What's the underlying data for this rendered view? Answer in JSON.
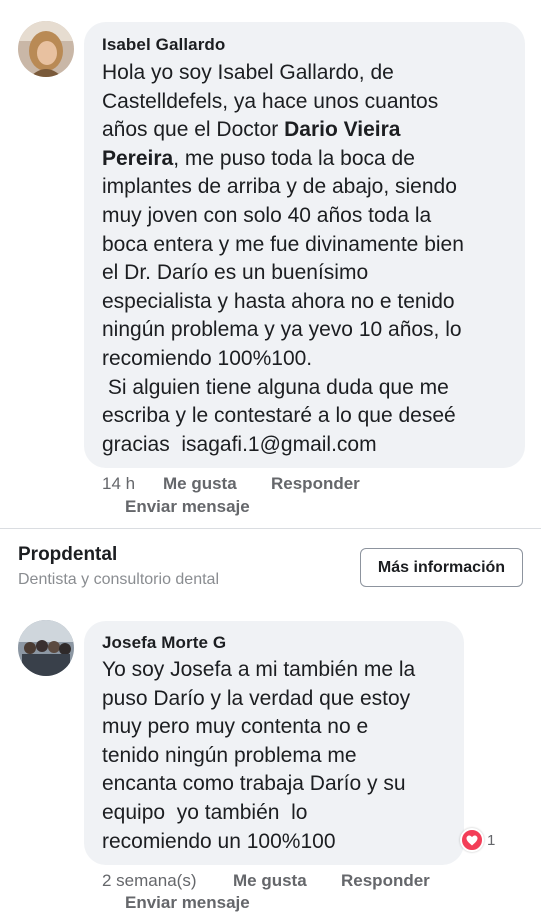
{
  "comments": [
    {
      "author": "Isabel Gallardo",
      "text_before": "Hola yo soy Isabel Gallardo, de\nCastelldefels, ya hace unos cuantos\naños que el Doctor ",
      "text_bold": "Dario Vieira\nPereira",
      "text_after": ", me puso toda la boca de\nimplantes de arriba y de abajo, siendo\nmuy joven con solo 40 años toda la\nboca entera y me fue divinamente bien\nel Dr. Darío es un buenísimo\nespecialista y hasta ahora no e tenido\nningún problema y ya yevo 10 años, lo\nrecomiendo 100%100.\n Si alguien tiene alguna duda que me\nescriba y le contestaré a lo que deseé\ngracias  isagafi.1@gmail.com",
      "time": "14 h",
      "like_label": "Me gusta",
      "reply_label": "Responder",
      "message_label": "Enviar mensaje"
    },
    {
      "author": "Josefa Morte G",
      "text": "Yo soy Josefa a mi también me la\npuso Darío y la verdad que estoy\nmuy pero muy contenta no e\ntenido ningún problema me\nencanta como trabaja Darío y su\nequipo  yo también  lo\nrecomiendo un 100%100",
      "time": "2 semana(s)",
      "like_label": "Me gusta",
      "reply_label": "Responder",
      "message_label": "Enviar mensaje",
      "reaction_count": "1",
      "reaction_icon": "heart-icon"
    }
  ],
  "page_card": {
    "name": "Propdental",
    "category": "Dentista y consultorio dental",
    "button_label": "Más información"
  },
  "colors": {
    "bubble": "#f0f2f5",
    "meta_text": "#65676b",
    "reaction": "#f33e58"
  }
}
